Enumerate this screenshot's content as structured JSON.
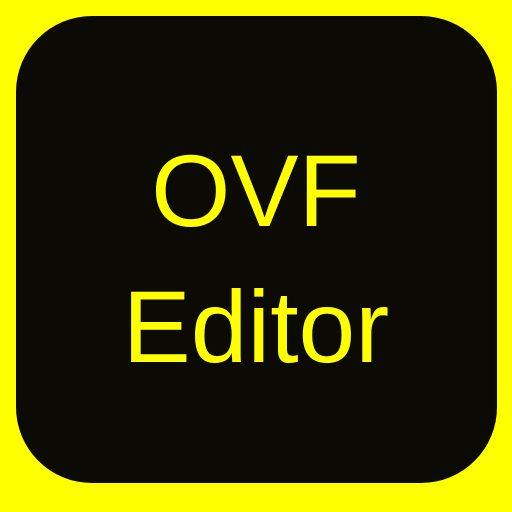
{
  "app_icon": {
    "line_1": "OVF",
    "line_2": "Editor"
  },
  "colors": {
    "background": "#ffff00",
    "tile": "#0b0a04",
    "text": "#ffff00"
  }
}
